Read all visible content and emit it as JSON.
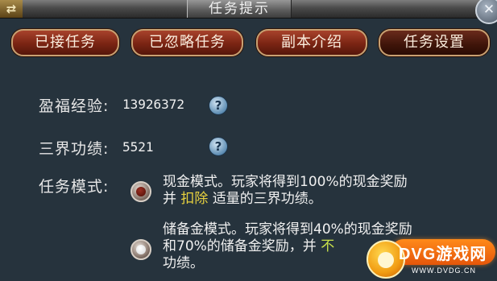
{
  "window": {
    "title": "任务提示",
    "menu_icon": "⇄",
    "close_icon": "✕"
  },
  "tabs": [
    {
      "label": "已接任务"
    },
    {
      "label": "已忽略任务"
    },
    {
      "label": "副本介绍"
    },
    {
      "label": "任务设置"
    }
  ],
  "stats": {
    "exp_label": "盈福经验:",
    "exp_value": "13926372",
    "merit_label": "三界功绩:",
    "merit_value": "5521",
    "help_glyph": "?"
  },
  "mode": {
    "label": "任务模式:",
    "options": [
      {
        "line1": "现金模式。玩家将得到100%的现金奖励",
        "line2_pre": "并",
        "line2_highlight": "扣除",
        "line2_post": "适量的三界功绩。",
        "selected": false
      },
      {
        "line1": "储备金模式。玩家将得到40%的现金奖励",
        "line2_pre": "和70%的储备金奖励，并",
        "line2_highlight": "不",
        "line3": "功绩。",
        "selected": true
      }
    ]
  },
  "watermark": {
    "brand": "DVG游戏网",
    "url": "WWW.DVDG.CN"
  }
}
